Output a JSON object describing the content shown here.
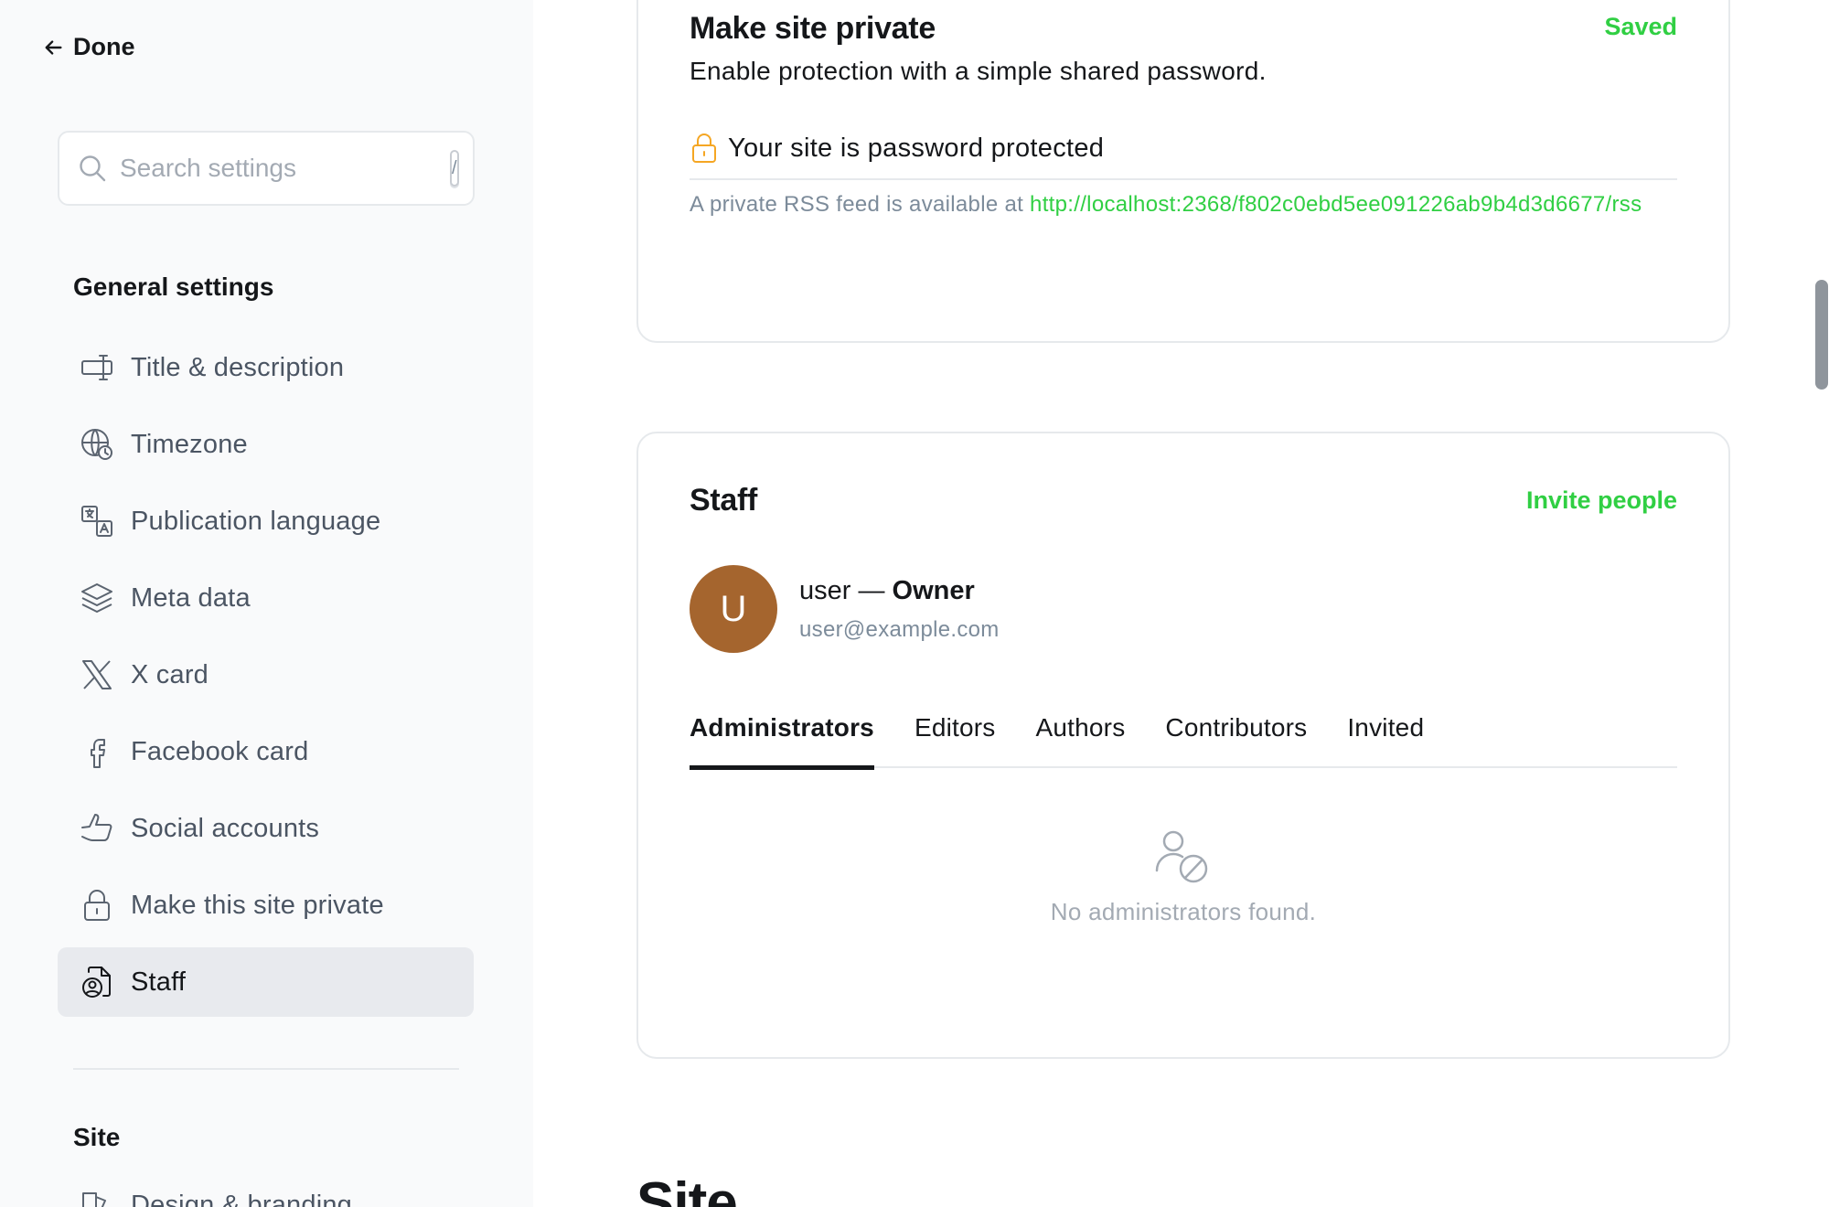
{
  "sidebar": {
    "done_label": "Done",
    "search": {
      "placeholder": "Search settings",
      "shortcut": "/"
    },
    "general_title": "General settings",
    "items": [
      {
        "label": "Title & description",
        "icon": "title-description-icon"
      },
      {
        "label": "Timezone",
        "icon": "globe-clock-icon"
      },
      {
        "label": "Publication language",
        "icon": "translate-icon"
      },
      {
        "label": "Meta data",
        "icon": "layers-icon"
      },
      {
        "label": "X card",
        "icon": "x-logo-icon"
      },
      {
        "label": "Facebook card",
        "icon": "facebook-icon"
      },
      {
        "label": "Social accounts",
        "icon": "thumbs-up-icon"
      },
      {
        "label": "Make this site private",
        "icon": "lock-icon"
      },
      {
        "label": "Staff",
        "icon": "staff-icon",
        "active": true
      }
    ],
    "site_title": "Site",
    "site_items": [
      {
        "label": "Design & branding",
        "icon": "design-icon"
      }
    ]
  },
  "private": {
    "title": "Make site private",
    "status": "Saved",
    "description": "Enable protection with a simple shared password.",
    "protected_text": "Your site is password protected",
    "rss_prefix": "A private RSS feed is available at ",
    "rss_url": "http://localhost:2368/f802c0ebd5ee091226ab9b4d3d6677/rss"
  },
  "staff": {
    "title": "Staff",
    "invite_label": "Invite people",
    "owner": {
      "initial": "U",
      "name": "user",
      "separator": " — ",
      "role": "Owner",
      "email": "user@example.com"
    },
    "tabs": [
      "Administrators",
      "Editors",
      "Authors",
      "Contributors",
      "Invited"
    ],
    "active_tab": "Administrators",
    "empty_text": "No administrators found."
  },
  "next_section_heading": "Site",
  "colors": {
    "accent": "#30cf43",
    "avatar": "#a5652e",
    "lock": "#f5a623",
    "sidebar_bg": "#f9fafb"
  }
}
